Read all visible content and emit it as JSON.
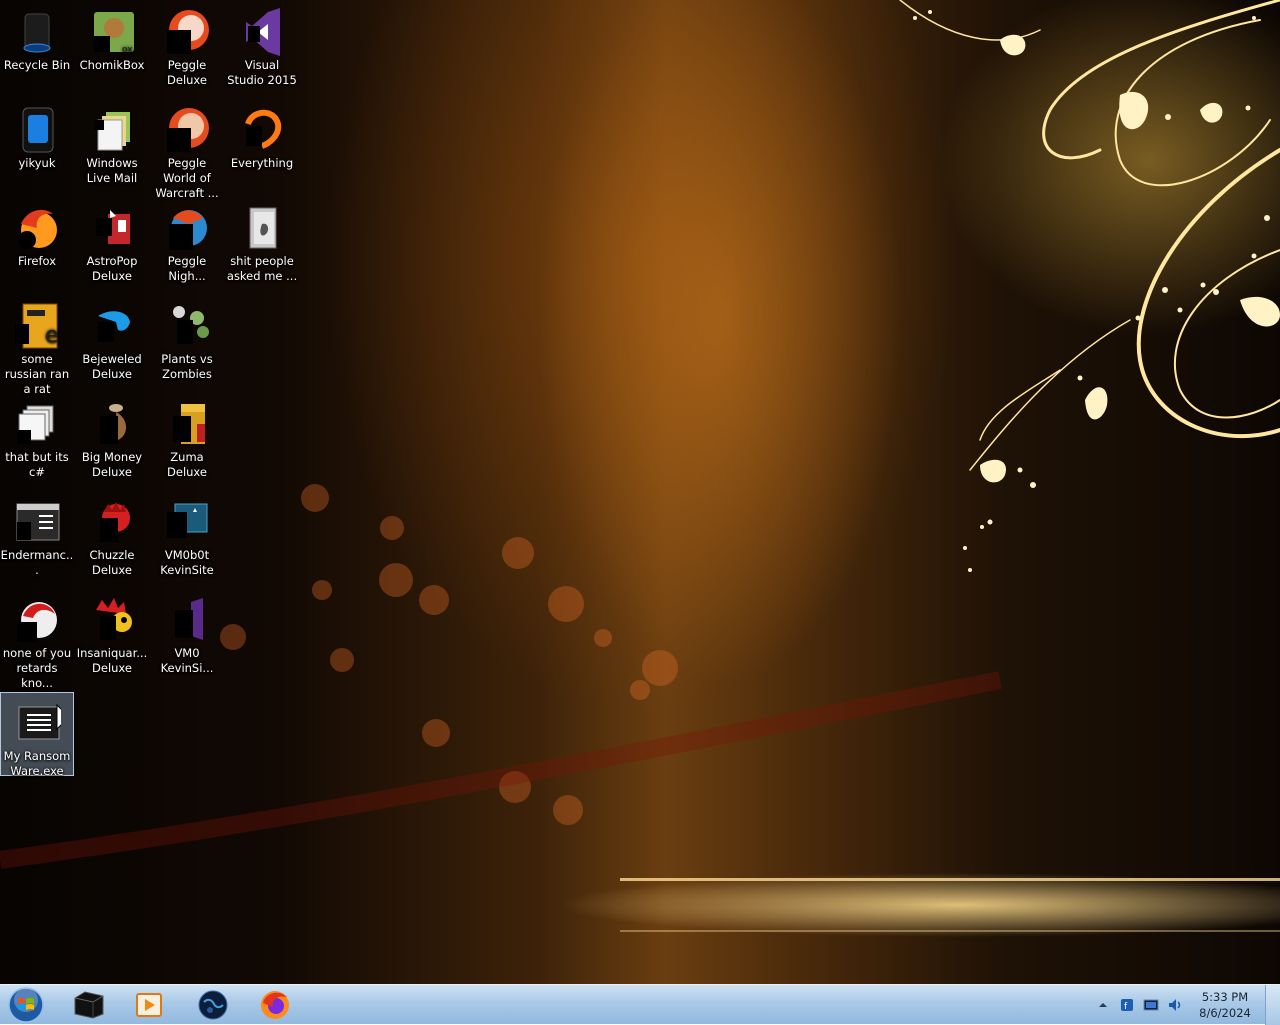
{
  "desktop": {
    "icons": [
      {
        "label": "Recycle Bin",
        "icon": "recycle-bin-icon"
      },
      {
        "label": "ChomikBox",
        "icon": "chomikbox-icon"
      },
      {
        "label": "Peggle Deluxe",
        "icon": "peggle-icon"
      },
      {
        "label": "Visual Studio 2015",
        "icon": "visual-studio-icon"
      },
      {
        "label": "yikyuk",
        "icon": "phone-app-icon"
      },
      {
        "label": "Windows Live Mail",
        "icon": "mail-icon"
      },
      {
        "label": "Peggle World of Warcraft ...",
        "icon": "peggle-icon"
      },
      {
        "label": "Everything",
        "icon": "search-app-icon"
      },
      {
        "label": "Firefox",
        "icon": "firefox-icon"
      },
      {
        "label": "AstroPop Deluxe",
        "icon": "game-icon"
      },
      {
        "label": "Peggle Nigh...",
        "icon": "peggle-icon"
      },
      {
        "label": "shit people asked me ...",
        "icon": "document-icon"
      },
      {
        "label": "some russian ran a rat",
        "icon": "shortcut-icon"
      },
      {
        "label": "Bejeweled Deluxe",
        "icon": "gem-icon"
      },
      {
        "label": "Plants vs Zombies",
        "icon": "plant-icon"
      },
      {
        "label": "that but its c#",
        "icon": "shortcut-icon"
      },
      {
        "label": "Big Money Deluxe",
        "icon": "game-icon"
      },
      {
        "label": "Zuma Deluxe",
        "icon": "game-icon"
      },
      {
        "label": "Endermanc...",
        "icon": "console-icon"
      },
      {
        "label": "Chuzzle Deluxe",
        "icon": "game-icon"
      },
      {
        "label": "VM0b0t KevinSite",
        "icon": "vm-icon"
      },
      {
        "label": "none of you retards kno...",
        "icon": "shortcut-icon"
      },
      {
        "label": "Insaniquar... Deluxe",
        "icon": "game-icon"
      },
      {
        "label": "VM0 KevinSi...",
        "icon": "visual-studio-icon"
      },
      {
        "label": "My Ransom Ware.exe",
        "icon": "console-icon",
        "selected": true
      }
    ]
  },
  "taskbar": {
    "start": "start-orb-icon",
    "pinned": [
      {
        "name": "cmd",
        "icon": "terminal-icon"
      },
      {
        "name": "media",
        "icon": "media-player-icon"
      },
      {
        "name": "globe",
        "icon": "globe-icon"
      },
      {
        "name": "firefox",
        "icon": "firefox-icon"
      }
    ],
    "tray": {
      "time": "5:33 PM",
      "date": "8/6/2024"
    }
  },
  "colors": {
    "taskbar": "#a9c9e7",
    "accent_gold": "#f2c75a",
    "selection": "#b4d2f0"
  }
}
